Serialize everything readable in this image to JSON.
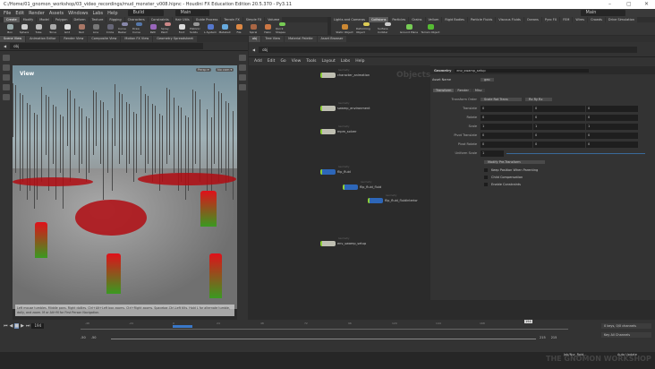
{
  "window": {
    "title": "C:/Home/01_gnomon_workshop/03_video_recordings/mud_monster_v008.hipnc - Houdini FX Education Edition 20.5.370 - Py3.11",
    "min": "–",
    "max": "▢",
    "close": "✕"
  },
  "menu": {
    "items": [
      "File",
      "Edit",
      "Render",
      "Assets",
      "Windows",
      "Labs",
      "Help"
    ],
    "desktop_left": "Build",
    "desktop_mid": "Main",
    "desktop_right": "Main"
  },
  "shelf_tabs_left": [
    "Create",
    "Modify",
    "Model",
    "Polygon",
    "Deform",
    "Texture",
    "Rigging",
    "Characters",
    "Constraints",
    "Hair Utils",
    "Guide Process",
    "Terrain FX",
    "Simple FX",
    "Volume"
  ],
  "shelf_tools_left": [
    "Box",
    "Sphere",
    "Tube",
    "Torus",
    "Grid",
    "Null",
    "Line",
    "Circle",
    "Curve Bezier",
    "Draw Curve",
    "Path",
    "Spray Paint",
    "Font",
    "Platonic Solids",
    "L-System",
    "Metaball",
    "File",
    "Spiral",
    "Helix",
    "Quick Shapes"
  ],
  "shelf_tabs_right": [
    "Lights and Cameras",
    "Collisions",
    "Particles",
    "Grains",
    "Vellum",
    "Rigid Bodies",
    "Particle Fluids",
    "Viscous Fluids",
    "Oceans",
    "Pyro FX",
    "FEM",
    "Wires",
    "Crowds",
    "Drive Simulation"
  ],
  "shelf_tools_right": [
    "Static Object",
    "Deforming Object",
    "Surface Collider",
    "Ground Plane",
    "Terrain Object"
  ],
  "left_pane_tabs": [
    "Scene View",
    "Animation Editor",
    "Render View",
    "Composite View",
    "Motion FX View",
    "Geometry Spreadsheet"
  ],
  "right_pane_tabs": [
    "obj",
    "Tree View",
    "Material Palette",
    "Asset Browser"
  ],
  "path": "obj",
  "viewport": {
    "title": "View",
    "persp": "Persp ▾",
    "cam": "No cam ▾",
    "hint": "Left mouse tumbles. Middle pans. Right dollies. Ctrl+Alt+Left box zooms. Ctrl+Right zooms. Spacebar-Ctrl-Left tilts. Hold L for alternate tumble, dolly, and zoom. M or Alt+M for First Person Navigation."
  },
  "network": {
    "menu": [
      "Add",
      "Edit",
      "Go",
      "View",
      "Tools",
      "Layout",
      "Labs",
      "Help"
    ],
    "context": "Objects",
    "nodes": [
      {
        "name": "character_animation",
        "type": "Geometry"
      },
      {
        "name": "swamp_environment",
        "type": "Geometry"
      },
      {
        "name": "mpm_solver",
        "type": "Geometry"
      },
      {
        "name": "flip_fluid",
        "type": "Geometry"
      },
      {
        "name": "flip_fluid_fluid",
        "type": "Geometry"
      },
      {
        "name": "flip_fluid_fluidinterior",
        "type": "Geometry"
      },
      {
        "name": "env_swamp_setup",
        "type": "Geometry"
      }
    ]
  },
  "params": {
    "node_type": "Geometry",
    "node_name": "env_swamp_setup",
    "asset_name_label": "Asset Name",
    "asset_name": "geo",
    "tabs": [
      "Transform",
      "Render",
      "Misc"
    ],
    "transform_order_label": "Transform Order",
    "transform_order": "Scale Rot Trans",
    "rot_order": "Rx Ry Rz",
    "rows": [
      {
        "label": "Translate",
        "v": [
          "0",
          "0",
          "0"
        ]
      },
      {
        "label": "Rotate",
        "v": [
          "0",
          "0",
          "0"
        ]
      },
      {
        "label": "Scale",
        "v": [
          "1",
          "1",
          "1"
        ]
      },
      {
        "label": "Pivot Translate",
        "v": [
          "0",
          "0",
          "0"
        ]
      },
      {
        "label": "Pivot Rotate",
        "v": [
          "0",
          "0",
          "0"
        ]
      }
    ],
    "uniform_scale_label": "Uniform Scale",
    "uniform_scale": "1",
    "uniform_scale_fraction": 1.0,
    "pre_transform": "Modify Pre-Transform",
    "checks": [
      "Keep Position When Parenting",
      "Child Compensation",
      "Enable Constraints"
    ]
  },
  "timeline": {
    "frame": "194",
    "ticks": [
      "-48",
      "-24",
      "0",
      "24",
      "48",
      "72",
      "96",
      "120",
      "144",
      "168"
    ],
    "start": "-50",
    "start2": "-50",
    "end": "215",
    "end2": "215",
    "keys": "0 keys, 0/0 channels",
    "key_all": "Key All Channels",
    "auto_update": "Auto Update",
    "job": "Job/Nur_Roid..."
  },
  "watermark": "THE GNOMON WORKSHOP"
}
